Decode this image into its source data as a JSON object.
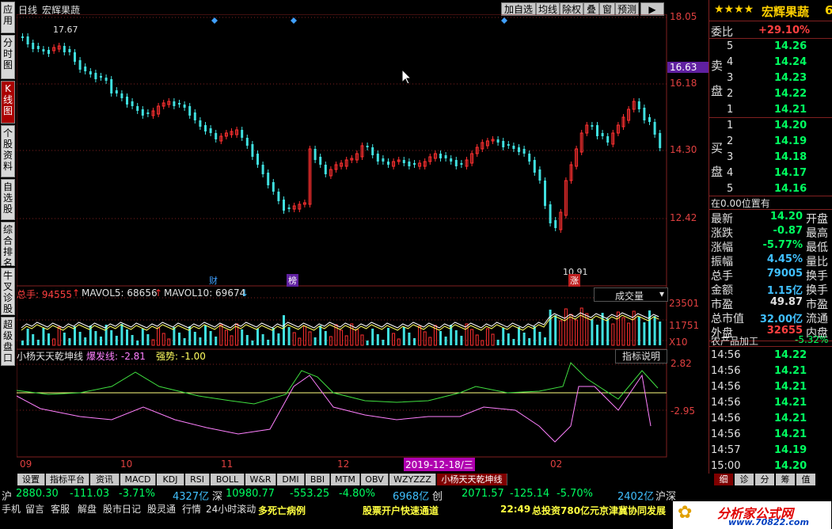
{
  "sidebar": [
    {
      "label": "应用",
      "active": false
    },
    {
      "label": "分时图",
      "active": false
    },
    {
      "label": "K线图",
      "active": true
    },
    {
      "label": "个股资料",
      "active": false
    },
    {
      "label": "自选股",
      "active": false
    },
    {
      "label": "综合排名",
      "active": false
    },
    {
      "label": "牛叉诊股",
      "active": false
    },
    {
      "label": "超级盘口",
      "active": false
    }
  ],
  "header": {
    "period": "日线",
    "stock_name": "宏辉果蔬",
    "buttons": [
      "加自选",
      "均线",
      "除权",
      "叠",
      "窗",
      "预测"
    ],
    "arrow": "▶"
  },
  "main_chart": {
    "y_ticks": [
      "18.05",
      "16.18",
      "14.30",
      "12.42"
    ],
    "current_price": "16.63",
    "high_label": "17.67",
    "low_label": "10.91",
    "markers": [
      "财",
      "榜",
      "涨"
    ]
  },
  "volume_panel": {
    "title": "总手: 94555",
    "ma5": "MAVOL5: 68656",
    "ma10": "MAVOL10: 69674",
    "dropdown": "成交量",
    "y_ticks": [
      "23501",
      "11751",
      "X10"
    ]
  },
  "indicator_panel": {
    "name": "小杨天天乾坤线",
    "burst": "爆发线: -2.81",
    "strength": "强势: -1.00",
    "button": "指标说明",
    "y_ticks": [
      "2.82",
      "-2.95"
    ]
  },
  "x_axis": {
    "labels": [
      "09",
      "10",
      "11",
      "12",
      "02"
    ],
    "highlight": "2019-12-18/三"
  },
  "right_panel": {
    "stars": "★★★★",
    "name": "宏辉果蔬",
    "code_digit": "6",
    "weibi_label": "委比",
    "weibi": "+29.10%",
    "sell_label": [
      "卖",
      "盘"
    ],
    "buy_label": [
      "买",
      "盘"
    ],
    "sell": [
      {
        "n": "5",
        "p": "14.26"
      },
      {
        "n": "4",
        "p": "14.24"
      },
      {
        "n": "3",
        "p": "14.23"
      },
      {
        "n": "2",
        "p": "14.22"
      },
      {
        "n": "1",
        "p": "14.21"
      }
    ],
    "buy": [
      {
        "n": "1",
        "p": "14.20"
      },
      {
        "n": "2",
        "p": "14.19"
      },
      {
        "n": "3",
        "p": "14.18"
      },
      {
        "n": "4",
        "p": "14.17"
      },
      {
        "n": "5",
        "p": "14.16"
      }
    ],
    "position": "在0.00位置有",
    "stats": [
      {
        "l": "最新",
        "v": "14.20",
        "c": "#00ff60",
        "r": "开盘"
      },
      {
        "l": "涨跌",
        "v": "-0.87",
        "c": "#00ff60",
        "r": "最高"
      },
      {
        "l": "涨幅",
        "v": "-5.77%",
        "c": "#00ff60",
        "r": "最低"
      },
      {
        "l": "振幅",
        "v": "4.45%",
        "c": "#40c0ff",
        "r": "量比"
      },
      {
        "l": "总手",
        "v": "79005",
        "c": "#40c0ff",
        "r": "换手"
      },
      {
        "l": "金额",
        "v": "1.15亿",
        "c": "#40c0ff",
        "r": "换手"
      },
      {
        "l": "市盈",
        "v": "49.87",
        "c": "#e0e0e0",
        "r": "市盈"
      },
      {
        "l": "总市值",
        "v": "32.00亿",
        "c": "#40c0ff",
        "r": "流通"
      },
      {
        "l": "外盘",
        "v": "32655",
        "c": "#ff4040",
        "r": "内盘"
      }
    ],
    "sector": "农产品加工",
    "sector_change": "-5.32%",
    "ticks": [
      {
        "t": "14:56",
        "p": "14.22"
      },
      {
        "t": "14:56",
        "p": "14.21"
      },
      {
        "t": "14:56",
        "p": "14.21"
      },
      {
        "t": "14:56",
        "p": "14.21"
      },
      {
        "t": "14:56",
        "p": "14.21"
      },
      {
        "t": "14:56",
        "p": "14.21"
      },
      {
        "t": "14:57",
        "p": "14.19"
      },
      {
        "t": "15:00",
        "p": "14.20"
      }
    ],
    "tabs": [
      "细",
      "诊",
      "分",
      "筹",
      "值"
    ]
  },
  "bottom_tabs": [
    {
      "label": "设置",
      "active": false
    },
    {
      "label": "指标平台",
      "active": false
    },
    {
      "label": "资讯",
      "active": false
    },
    {
      "label": "MACD",
      "active": false
    },
    {
      "label": "KDJ",
      "active": false
    },
    {
      "label": "RSI",
      "active": false
    },
    {
      "label": "BOLL",
      "active": false
    },
    {
      "label": "W&R",
      "active": false
    },
    {
      "label": "DMI",
      "active": false
    },
    {
      "label": "BBI",
      "active": false
    },
    {
      "label": "MTM",
      "active": false
    },
    {
      "label": "OBV",
      "active": false
    },
    {
      "label": "WZYZZZ",
      "active": false
    },
    {
      "label": "小杨天天乾坤线",
      "active": true
    }
  ],
  "ticker": {
    "sh_label": "沪",
    "sh_val": "2880.30",
    "sh_chg": "-111.03",
    "sh_pct": "-3.71%",
    "sh_amt": "4327亿",
    "sz_label": "深",
    "sz_val": "10980.77",
    "sz_chg": "-553.25",
    "sz_pct": "-4.80%",
    "sz_amt": "6968亿",
    "cy_label": "创",
    "cy_val": "2071.57",
    "cy_chg": "-125.14",
    "cy_pct": "-5.70%",
    "cy_amt": "2402亿",
    "tail": "沪深"
  },
  "news": {
    "buttons": [
      "手机",
      "留言",
      "客服",
      "解盘",
      "股市日记",
      "股灵通",
      "行情",
      "24小时滚动"
    ],
    "headline1": "多死亡病例",
    "headline2": "股票开户快速通道",
    "time": "22:49",
    "headline3": "总投资780亿元京津冀协同发展",
    "watermark": "分析家公式网",
    "watermark_url": "www.70822.com"
  },
  "colors": {
    "up": "#ff3030",
    "down": "#40e0e0",
    "grid": "#802020",
    "ma": "#ffff80"
  }
}
